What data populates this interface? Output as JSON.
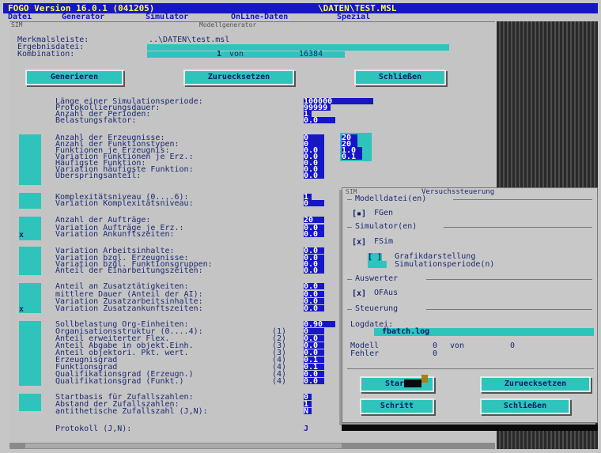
{
  "titlebar": {
    "left": "FOGO Version 16.0.1 (041205)",
    "right": "\\DATEN\\TEST.MSL"
  },
  "menu": [
    "Datei",
    "Generator",
    "Simulator",
    "OnLine-Daten",
    "Spezial"
  ],
  "mainwin": {
    "title": "Modellgenerator",
    "tag": "SIM"
  },
  "header": {
    "merkmal_label": "Merkmalsleiste:",
    "merkmal_value": "..\\DATEN\\test.msl",
    "ergebnis_label": "Ergebnisdatei:",
    "kombination_label": "Kombination:",
    "kombination_value": "1",
    "von_label": "von",
    "total": "16384"
  },
  "buttons": {
    "generieren": "Generieren",
    "zuruecksetzen": "Zuruecksetzen",
    "schliessen": "Schließen"
  },
  "block1": {
    "lines": [
      "Länge einer Simulationsperiode:",
      "Protokollierungsdauer:",
      "Anzahl der Perioden:",
      "Belastungsfaktor:"
    ],
    "values": [
      "100000",
      "99999",
      "1",
      "0.0"
    ]
  },
  "block2": {
    "lines": [
      "Anzahl der Erzeugnisse:",
      "Anzahl der Funktionstypen:",
      "Funktionen je Erzeugnis:",
      "Variation Funktionen je Erz.:",
      "Häufigste Funktion:",
      "Variation häufigste Funktion:",
      "Überspringsanteil:"
    ],
    "values": [
      "0",
      "0",
      "0.0",
      "0.0",
      "0.0",
      "0.0",
      "0.0"
    ],
    "values2": [
      "20",
      "20",
      "1.0",
      "0.1"
    ]
  },
  "block3": {
    "lines": [
      "Komplexitätsniveau (0....6):",
      "Variation Komplexitätsniveau:"
    ],
    "values": [
      "1",
      "0"
    ]
  },
  "block4": {
    "lines": [
      "Anzahl der Aufträge:",
      "Variation Aufträge je Erz.:",
      "Variation Ankunftszeiten:"
    ],
    "values": [
      "20",
      "0.0",
      "0.0"
    ],
    "mark": "x"
  },
  "block5": {
    "lines": [
      "Variation Arbeitsinhalte:",
      "Variation bzgl. Erzeugnisse:",
      "Variation bzgl. Funktionsgruppen:",
      "Anteil der Einarbeitungszeiten:"
    ],
    "values": [
      "0.0",
      "0.0",
      "0.0",
      "0.0"
    ]
  },
  "block6": {
    "lines": [
      "Anteil an Zusatztätigkeiten:",
      "mittlere Dauer (Anteil der AI):",
      "Variation Zusatzarbeitsinhalte:",
      "Variation Zusatzankunftszeiten:"
    ],
    "values": [
      "0.0",
      "0.0",
      "0.0",
      "0.0"
    ],
    "mark": "x"
  },
  "block7": {
    "lines": [
      "Sollbelastung Org-Einheiten:",
      "Organisationsstruktur (0....4):",
      "Anteil erweiterter Flex.",
      "Anteil Abgabe in objekt.Einh.",
      "Anteil objektori. Pkt. wert.",
      "Erzeugnisgrad",
      "Funktionsgrad",
      "Qualifikationsgrad (Erzeugn.)",
      "Qualifikationsgrad (Funkt.)"
    ],
    "refs": [
      "",
      "(1)",
      "(2)",
      "(3)",
      "(3)",
      "(4)",
      "(4)",
      "(4)",
      "(4)"
    ],
    "values": [
      "0.90",
      "0",
      "0.0",
      "0.0",
      "0.0",
      "0.1",
      "0.1",
      "0.0",
      "0.0"
    ]
  },
  "block8": {
    "lines": [
      "Startbasis für Zufallszahlen:",
      "Abstand der Zufallszahlen:",
      "antithetische Zufallszahl (J,N):"
    ],
    "values": [
      "0",
      "1",
      "N"
    ]
  },
  "protokoll": {
    "label": "Protokoll (J,N):",
    "value": "J"
  },
  "dialog": {
    "tag": "SIM",
    "title": "Versuchssteuerung",
    "group_modell": "Modelldatei(en)",
    "fgen": "FGen",
    "group_sim": "Simulator(en)",
    "fsim": "FSim",
    "grafik": "Grafikdarstellung",
    "simper": "Simulationsperiode(n)",
    "group_auswerter": "Auswerter",
    "ofaus": "OFAus",
    "group_steuerung": "Steuerung",
    "logdatei_label": "Logdatei:",
    "logdatei_value": "fbatch.log",
    "modell_label": "Modell",
    "modell_value": "0",
    "von_label": "von",
    "modell_total": "0",
    "fehler_label": "Fehler",
    "fehler_value": "0",
    "buttons": {
      "start": "Start",
      "zuruecksetzen": "Zuruecksetzen",
      "schritt": "Schritt",
      "schliessen": "Schließen"
    }
  },
  "colors": {
    "title_bg": "#1616c8",
    "title_fg": "#ffff40",
    "cyan": "#2ec4bc",
    "value_bg": "#1616c8",
    "window_bg": "#c4c4c4"
  }
}
